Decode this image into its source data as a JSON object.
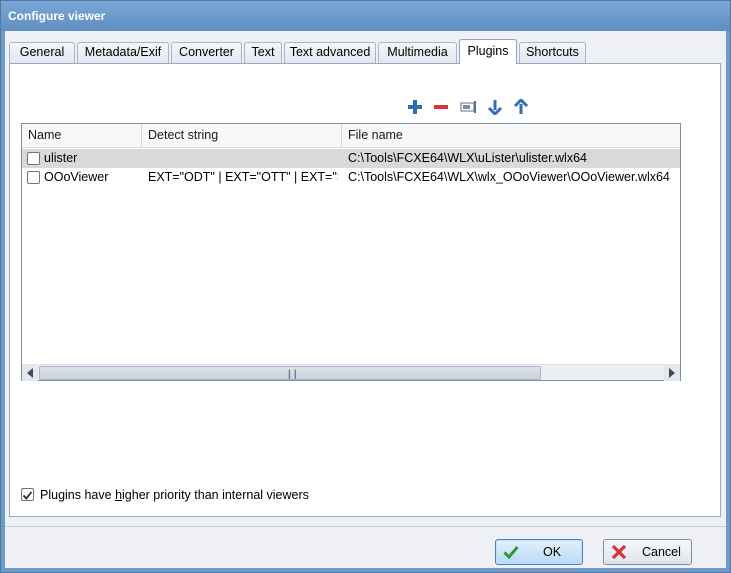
{
  "window": {
    "title": "Configure viewer"
  },
  "tabs": [
    {
      "label": "General"
    },
    {
      "label": "Metadata/Exif"
    },
    {
      "label": "Converter"
    },
    {
      "label": "Text"
    },
    {
      "label": "Text advanced"
    },
    {
      "label": "Multimedia"
    },
    {
      "label": "Plugins",
      "active": true
    },
    {
      "label": "Shortcuts"
    }
  ],
  "toolbar": {
    "icons": [
      "add-icon",
      "remove-icon",
      "configure-icon",
      "move-down-icon",
      "move-up-icon"
    ],
    "accent_blue": "#2f6fb8",
    "accent_red": "#d8333a"
  },
  "plugins_list": {
    "columns": [
      "Name",
      "Detect string",
      "File name"
    ],
    "rows": [
      {
        "checked": false,
        "name": "ulister",
        "detect": "",
        "file": "C:\\Tools\\FCXE64\\WLX\\uLister\\ulister.wlx64",
        "selected": true
      },
      {
        "checked": false,
        "name": "OOoViewer",
        "detect": "EXT=\"ODT\" | EXT=\"OTT\" | EXT=\"S...",
        "file": "C:\\Tools\\FCXE64\\WLX\\wlx_OOoViewer\\OOoViewer.wlx64",
        "selected": false
      }
    ]
  },
  "priority_checkbox": {
    "checked": true,
    "label_before": "Plugins have ",
    "label_accel": "h",
    "label_after": "igher priority than internal viewers"
  },
  "buttons": {
    "ok": "OK",
    "cancel": "Cancel"
  }
}
